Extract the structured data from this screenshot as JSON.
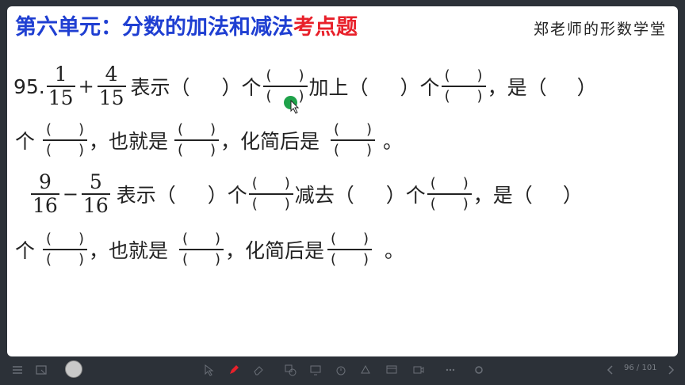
{
  "title": {
    "part1": "第六单元：分数的加法和减法",
    "part2": "考点题"
  },
  "brand": "郑老师的形数学堂",
  "line1": {
    "num": "95.",
    "f1n": "1",
    "f1d": "15",
    "op": "+",
    "f2n": "4",
    "f2d": "15",
    "a": "表示（",
    "b": "）个",
    "c": "加上（",
    "d": "）个",
    "e": "，是（",
    "f": "）"
  },
  "line2": {
    "a": "个",
    "b": "，也就是",
    "c": "，化简后是",
    "d": "。"
  },
  "line3": {
    "f1n": "9",
    "f1d": "16",
    "op": "−",
    "f2n": "5",
    "f2d": "16",
    "a": "表示（",
    "b": "）个",
    "c": "减去（",
    "d": "）个",
    "e": "，是（",
    "f": "）"
  },
  "line4": {
    "a": "个",
    "b": "，也就是",
    "c": "，化简后是",
    "d": "。"
  },
  "blank": {
    "open": "(",
    "close": ")"
  },
  "toolbar": {
    "page": "96 / 101"
  },
  "colors": {
    "title_blue": "#1f3fd2",
    "title_red": "#e8202a",
    "cursor": "#1fa24a"
  }
}
